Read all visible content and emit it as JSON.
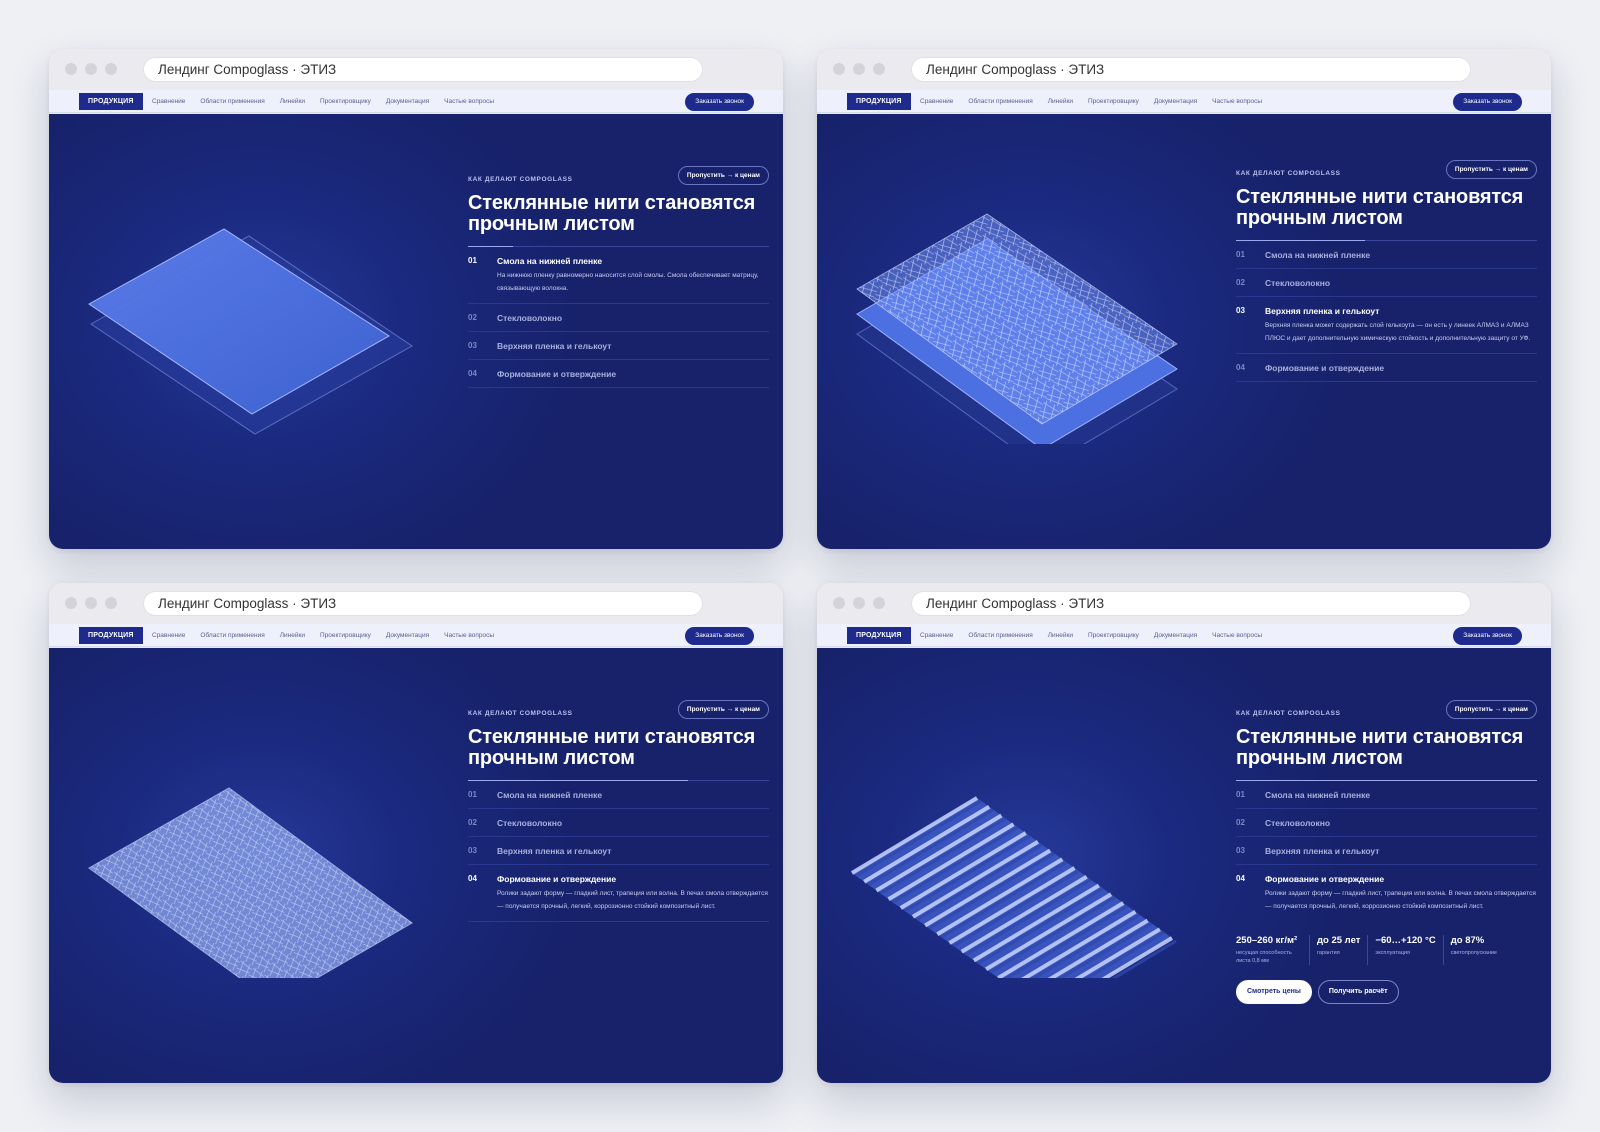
{
  "windows": [
    {
      "url": "Лендинг Compoglass · ЭТИЗ",
      "nav": {
        "primary": "ПРОДУКЦИЯ",
        "links": [
          "Сравнение",
          "Области применения",
          "Линейки",
          "Проектировщику",
          "Документация",
          "Частые вопросы"
        ],
        "cta": "Заказать звонок"
      },
      "hero": {
        "eyebrow": "КАК ДЕЛАЮТ COMPOGLASS",
        "skip": "Пропустить → к ценам",
        "title": "Стеклянные нити становятся прочным листом",
        "steps": [
          {
            "num": "01",
            "title": "Смола на нижней пленке",
            "desc": "На нижнюю пленку равномерно наносится слой смолы. Смола обеспечивает матрицу, связывающую волокна."
          },
          {
            "num": "02",
            "title": "Стекловолокно"
          },
          {
            "num": "03",
            "title": "Верхняя пленка и гелькоут"
          },
          {
            "num": "04",
            "title": "Формование и отверждение"
          }
        ],
        "active_step": 1,
        "progress": 0.15
      }
    },
    {
      "url": "Лендинг Compoglass · ЭТИЗ",
      "nav": {
        "primary": "ПРОДУКЦИЯ",
        "links": [
          "Сравнение",
          "Области применения",
          "Линейки",
          "Проектировщику",
          "Документация",
          "Частые вопросы"
        ],
        "cta": "Заказать звонок"
      },
      "hero": {
        "eyebrow": "КАК ДЕЛАЮТ COMPOGLASS",
        "skip": "Пропустить → к ценам",
        "title": "Стеклянные нити становятся прочным листом",
        "steps": [
          {
            "num": "01",
            "title": "Смола на нижней пленке"
          },
          {
            "num": "02",
            "title": "Стекловолокно"
          },
          {
            "num": "03",
            "title": "Верхняя пленка и гелькоут",
            "desc": "Верхняя пленка может содержать слой гелькоута — он есть у линеек АЛМАЗ и АЛМАЗ ПЛЮС и дает дополнительную химическую стойкость и дополнительную защиту от УФ."
          },
          {
            "num": "04",
            "title": "Формование и отверждение"
          }
        ],
        "active_step": 3,
        "progress": 0.43
      }
    },
    {
      "url": "Лендинг Compoglass · ЭТИЗ",
      "nav": {
        "primary": "ПРОДУКЦИЯ",
        "links": [
          "Сравнение",
          "Области применения",
          "Линейки",
          "Проектировщику",
          "Документация",
          "Частые вопросы"
        ],
        "cta": "Заказать звонок"
      },
      "hero": {
        "eyebrow": "КАК ДЕЛАЮТ COMPOGLASS",
        "skip": "Пропустить → к ценам",
        "title": "Стеклянные нити становятся прочным листом",
        "steps": [
          {
            "num": "01",
            "title": "Смола на нижней пленке"
          },
          {
            "num": "02",
            "title": "Стекловолокно"
          },
          {
            "num": "03",
            "title": "Верхняя пленка и гелькоут"
          },
          {
            "num": "04",
            "title": "Формование и отверждение",
            "desc": "Ролики задают форму — гладкий лист, трапеция или волна. В печах смола отверждается — получается прочный, легкий, коррозионно стойкий композитный лист."
          }
        ],
        "active_step": 4,
        "progress": 0.73
      }
    },
    {
      "url": "Лендинг Compoglass · ЭТИЗ",
      "nav": {
        "primary": "ПРОДУКЦИЯ",
        "links": [
          "Сравнение",
          "Области применения",
          "Линейки",
          "Проектировщику",
          "Документация",
          "Частые вопросы"
        ],
        "cta": "Заказать звонок"
      },
      "hero": {
        "eyebrow": "КАК ДЕЛАЮТ COMPOGLASS",
        "skip": "Пропустить → к ценам",
        "title": "Стеклянные нити становятся прочным листом",
        "steps": [
          {
            "num": "01",
            "title": "Смола на нижней пленке"
          },
          {
            "num": "02",
            "title": "Стекловолокно"
          },
          {
            "num": "03",
            "title": "Верхняя пленка и гелькоут"
          },
          {
            "num": "04",
            "title": "Формование и отверждение",
            "desc": "Ролики задают форму — гладкий лист, трапеция или волна. В печах смола отверждается — получается прочный, легкий, коррозионно стойкий композитный лист."
          }
        ],
        "active_step": 4,
        "progress": 1.0,
        "stats": [
          {
            "value": "250–260 кг/м²",
            "label": "несущая способность листа 0,8 мм"
          },
          {
            "value": "до 25 лет",
            "label": "гарантия"
          },
          {
            "value": "−60…+120 °С",
            "label": "эксплуатация"
          },
          {
            "value": "до 87%",
            "label": "светопропускание"
          }
        ],
        "primary_button": "Смотреть цены",
        "secondary_button": "Получить расчёт"
      }
    }
  ],
  "colors": {
    "page_bg": "#eef0f4",
    "hero_bg": "#1b2a80",
    "accent": "#1f2b8c",
    "sheet_blue": "#4a6fe0"
  }
}
